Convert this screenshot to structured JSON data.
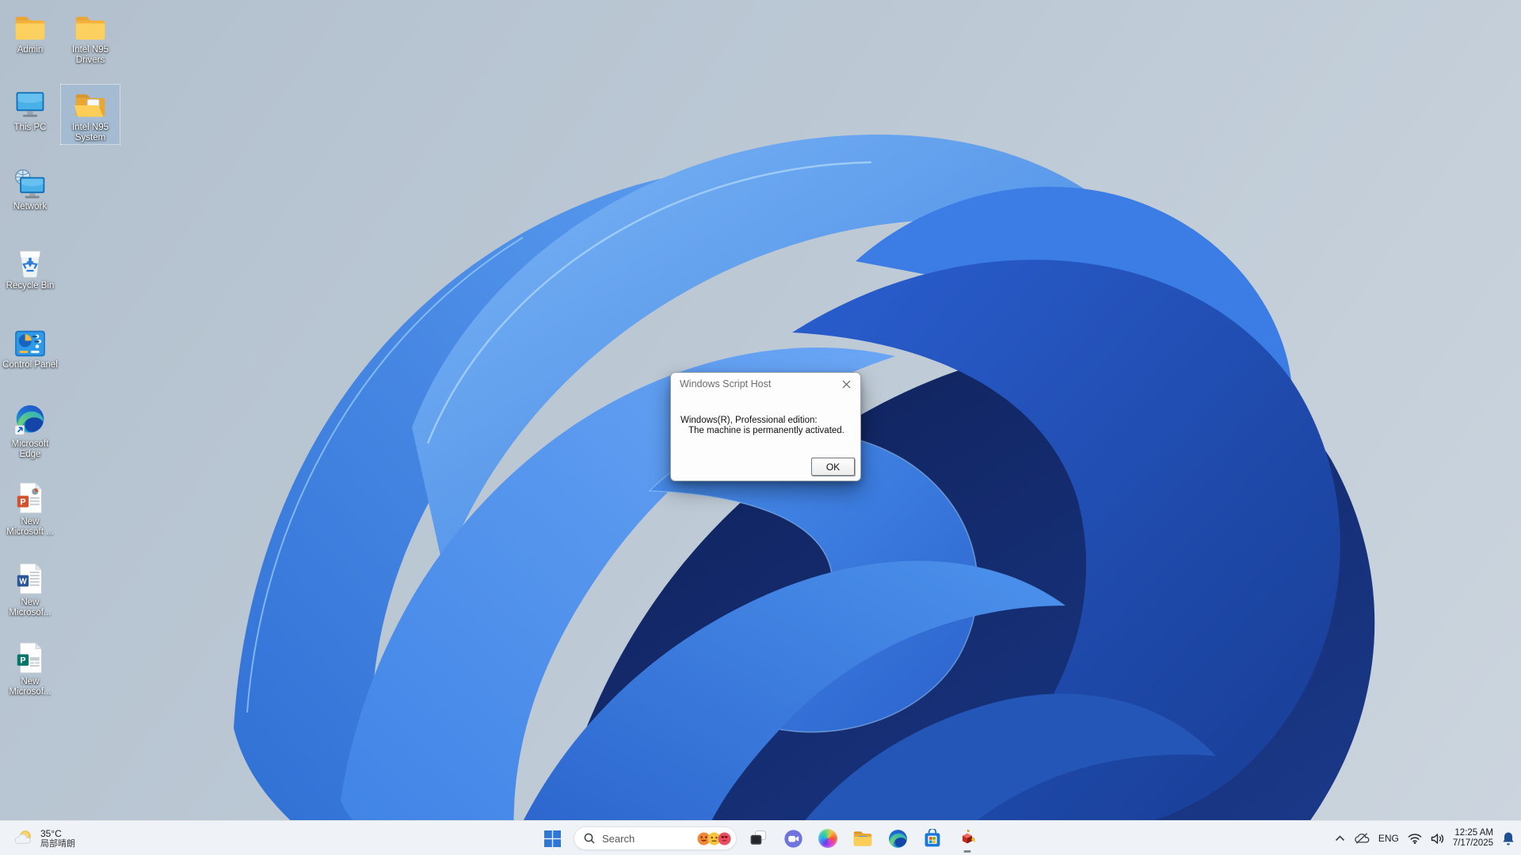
{
  "colors": {
    "taskbar_bg": "#eff3f8",
    "start_blue": "#2e77d6",
    "bell_blue": "#1d4f92",
    "dialog_bg": "#fdfdfd",
    "dialog_title_text": "#6e6e6e",
    "search_pill_bg": "#ffffff",
    "desktop_label_text": "#ffffff",
    "wallpaper_sky": "#bcc9d5",
    "bloom_deep_blue": "#173c92",
    "bloom_bright_blue": "#4a90ee"
  },
  "desktop": {
    "icons": [
      {
        "label": "Admin",
        "icon": "folder-icon"
      },
      {
        "label": "Intel N95 Drivers",
        "icon": "folder-icon"
      },
      {
        "label": "This PC",
        "icon": "computer-icon"
      },
      {
        "label": "Intel N95 System",
        "icon": "folder-open-icon",
        "selected": true
      },
      {
        "label": "Network",
        "icon": "network-icon"
      },
      {
        "label": "Recycle Bin",
        "icon": "recycle-bin-icon"
      },
      {
        "label": "Control Panel",
        "icon": "control-panel-icon"
      },
      {
        "label": "Microsoft Edge",
        "icon": "edge-icon"
      },
      {
        "label": "New Microsoft ...",
        "icon": "powerpoint-doc-icon"
      },
      {
        "label": "New Microsof...",
        "icon": "word-doc-icon"
      },
      {
        "label": "New Microsof...",
        "icon": "publisher-doc-icon"
      }
    ]
  },
  "dialog": {
    "title": "Windows Script Host",
    "body_line1": "Windows(R), Professional edition:",
    "body_line2": "The machine is permanently activated.",
    "ok_label": "OK",
    "close_icon": "close-icon"
  },
  "taskbar": {
    "weather": {
      "temperature": "35°C",
      "condition": "局部晴朗",
      "icon": "partly-sunny-icon"
    },
    "search": {
      "placeholder": "Search",
      "highlight_icons": [
        "emoji-heart-eyes-icon",
        "emoji-neutral-face-icon",
        "emoji-love-face-icon"
      ]
    },
    "apps": [
      {
        "name": "task-view"
      },
      {
        "name": "chat"
      },
      {
        "name": "copilot"
      },
      {
        "name": "file-explorer"
      },
      {
        "name": "microsoft-edge"
      },
      {
        "name": "microsoft-store"
      },
      {
        "name": "windows-script-host",
        "running": true
      }
    ],
    "tray": {
      "language": "ENG",
      "time": "12:25 AM",
      "date": "7/17/2025"
    }
  }
}
